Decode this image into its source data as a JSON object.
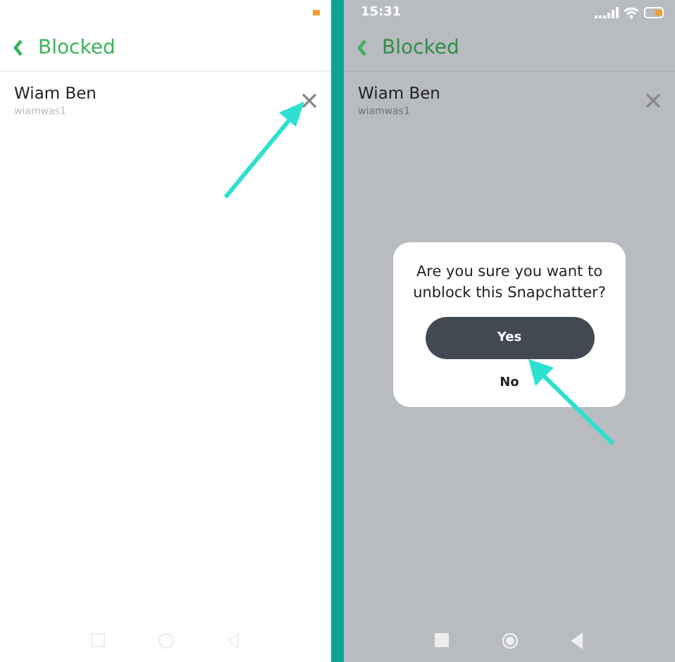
{
  "screens": [
    {
      "dimmed": false,
      "header": {
        "title": "Blocked"
      },
      "blocked": [
        {
          "name": "Wiam Ben",
          "username": "wiamwas1"
        }
      ]
    },
    {
      "dimmed": true,
      "status_bar": {
        "time": "15:31"
      },
      "header": {
        "title": "Blocked"
      },
      "blocked": [
        {
          "name": "Wiam Ben",
          "username": "wiamwas1"
        }
      ],
      "dialog": {
        "message": "Are you sure you want to unblock this Snapchatter?",
        "buttons": [
          {
            "label": "Yes",
            "kind": "primary"
          },
          {
            "label": "No",
            "kind": "plain"
          }
        ]
      }
    }
  ]
}
